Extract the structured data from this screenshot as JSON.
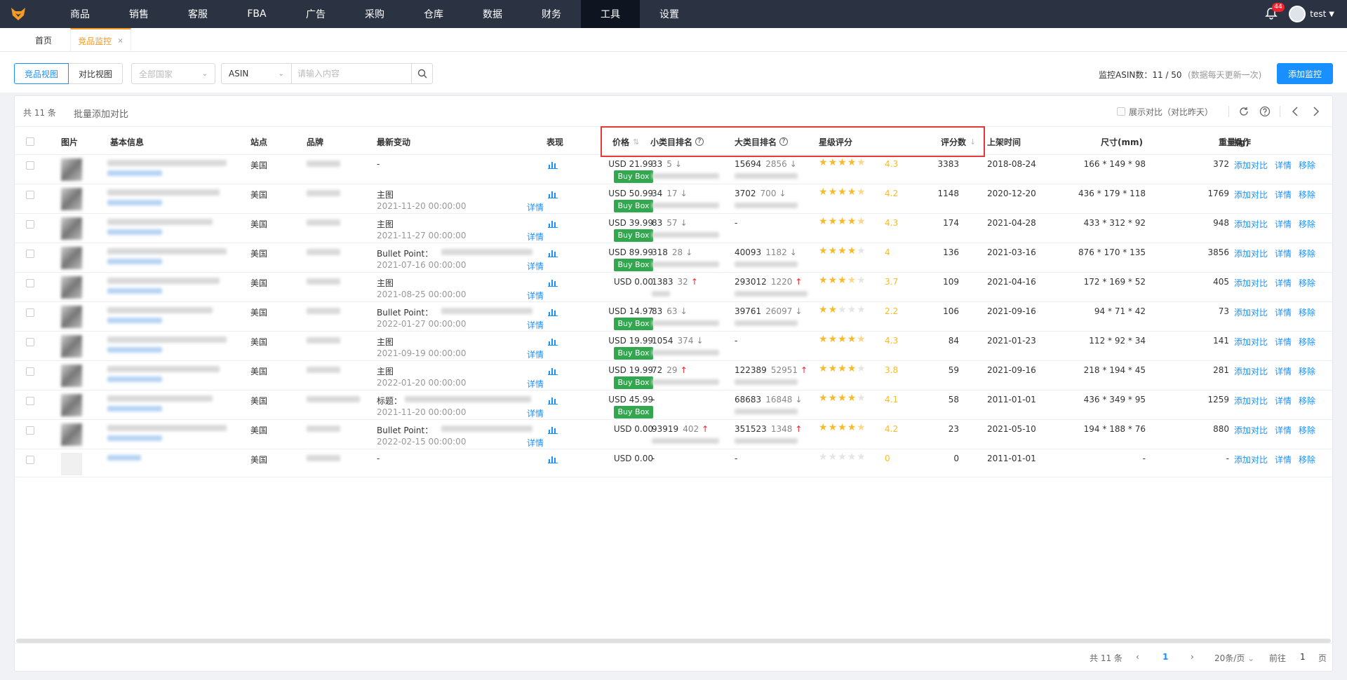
{
  "nav": {
    "items": [
      "商品",
      "销售",
      "客服",
      "FBA",
      "广告",
      "采购",
      "仓库",
      "数据",
      "财务",
      "工具",
      "设置"
    ],
    "active_index": 9,
    "notification_count": "44",
    "user": "test"
  },
  "tabs": {
    "home": "首页",
    "current": "竞品监控",
    "close": "×"
  },
  "toolbar": {
    "view_competitor": "竞品视图",
    "view_compare": "对比视图",
    "country_placeholder": "全部国家",
    "search_type": "ASIN",
    "search_placeholder": "请输入内容",
    "monitor_count": "监控ASIN数：11 / 50",
    "monitor_note": "(数据每天更新一次)",
    "add_button": "添加监控"
  },
  "panel": {
    "total": "共 11 条",
    "batch_add": "批量添加对比",
    "show_compare": "展示对比（对比昨天）"
  },
  "table": {
    "headers": {
      "image": "图片",
      "basic_info": "基本信息",
      "site": "站点",
      "brand": "品牌",
      "latest_change": "最新变动",
      "performance": "表现",
      "price": "价格",
      "small_rank": "小类目排名",
      "big_rank": "大类目排名",
      "star_rating": "星级评分",
      "review_count": "评分数",
      "listing_time": "上架时间",
      "size": "尺寸(mm)",
      "weight": "重量(g)",
      "actions": "操作"
    },
    "action_add_compare": "添加对比",
    "action_detail": "详情",
    "action_remove": "移除",
    "detail_link": "详情",
    "buy_box": "Buy Box",
    "rows": [
      {
        "site": "美国",
        "change": "-",
        "change_time": "",
        "price": "USD 21.99",
        "buybox": true,
        "small_rank": "33",
        "small_delta": "5",
        "small_dir": "down",
        "big_rank": "15694",
        "big_delta": "2856",
        "big_dir": "down",
        "stars": 4.5,
        "rating": "4.3",
        "reviews": "3383",
        "listed": "2018-08-24",
        "size": "166 * 149 * 98",
        "weight": "372"
      },
      {
        "site": "美国",
        "change": "主图",
        "change_time": "2021-11-20 00:00:00",
        "price": "USD 50.99",
        "buybox": true,
        "small_rank": "34",
        "small_delta": "17",
        "small_dir": "down",
        "big_rank": "3702",
        "big_delta": "700",
        "big_dir": "down",
        "stars": 4.5,
        "rating": "4.2",
        "reviews": "1148",
        "listed": "2020-12-20",
        "size": "436 * 179 * 118",
        "weight": "1769"
      },
      {
        "site": "美国",
        "change": "主图",
        "change_time": "2021-11-27 00:00:00",
        "price": "USD 39.99",
        "buybox": true,
        "small_rank": "83",
        "small_delta": "57",
        "small_dir": "down",
        "big_rank": "-",
        "big_delta": "",
        "big_dir": "",
        "stars": 4.5,
        "rating": "4.3",
        "reviews": "174",
        "listed": "2021-04-28",
        "size": "433 * 312 * 92",
        "weight": "948"
      },
      {
        "site": "美国",
        "change": "Bullet Point：",
        "change_time": "2021-07-16 00:00:00",
        "price": "USD 89.99",
        "buybox": true,
        "small_rank": "318",
        "small_delta": "28",
        "small_dir": "down",
        "big_rank": "40093",
        "big_delta": "1182",
        "big_dir": "down",
        "stars": 4,
        "rating": "4",
        "reviews": "136",
        "listed": "2021-03-16",
        "size": "876 * 170 * 135",
        "weight": "3856"
      },
      {
        "site": "美国",
        "change": "主图",
        "change_time": "2021-08-25 00:00:00",
        "price": "USD 0.00",
        "buybox": false,
        "small_rank": "1383",
        "small_delta": "32",
        "small_dir": "up",
        "big_rank": "293012",
        "big_delta": "1220",
        "big_dir": "up",
        "stars": 3.5,
        "rating": "3.7",
        "reviews": "109",
        "listed": "2021-04-16",
        "size": "172 * 169 * 52",
        "weight": "405"
      },
      {
        "site": "美国",
        "change": "Bullet Point：",
        "change_time": "2022-01-27 00:00:00",
        "price": "USD 14.97",
        "buybox": true,
        "small_rank": "83",
        "small_delta": "63",
        "small_dir": "down",
        "big_rank": "39761",
        "big_delta": "26097",
        "big_dir": "down",
        "stars": 2,
        "rating": "2.2",
        "reviews": "106",
        "listed": "2021-09-16",
        "size": "94 * 71 * 42",
        "weight": "73"
      },
      {
        "site": "美国",
        "change": "主图",
        "change_time": "2021-09-19 00:00:00",
        "price": "USD 19.99",
        "buybox": true,
        "small_rank": "1054",
        "small_delta": "374",
        "small_dir": "down",
        "big_rank": "-",
        "big_delta": "",
        "big_dir": "",
        "stars": 4.5,
        "rating": "4.3",
        "reviews": "84",
        "listed": "2021-01-23",
        "size": "112 * 92 * 34",
        "weight": "141"
      },
      {
        "site": "美国",
        "change": "主图",
        "change_time": "2022-01-20 00:00:00",
        "price": "USD 19.99",
        "buybox": true,
        "small_rank": "72",
        "small_delta": "29",
        "small_dir": "up",
        "big_rank": "122389",
        "big_delta": "52951",
        "big_dir": "up",
        "stars": 4,
        "rating": "3.8",
        "reviews": "59",
        "listed": "2021-09-16",
        "size": "218 * 194 * 45",
        "weight": "281"
      },
      {
        "site": "美国",
        "change": "标题：",
        "change_time": "2021-11-20 00:00:00",
        "price": "USD 45.99",
        "buybox": true,
        "small_rank": "-",
        "small_delta": "",
        "small_dir": "",
        "big_rank": "68683",
        "big_delta": "16848",
        "big_dir": "down",
        "stars": 4,
        "rating": "4.1",
        "reviews": "58",
        "listed": "2011-01-01",
        "size": "436 * 349 * 95",
        "weight": "1259"
      },
      {
        "site": "美国",
        "change": "Bullet Point：",
        "change_time": "2022-02-15 00:00:00",
        "price": "USD 0.00",
        "buybox": false,
        "small_rank": "93919",
        "small_delta": "402",
        "small_dir": "up",
        "big_rank": "351523",
        "big_delta": "1348",
        "big_dir": "up",
        "stars": 4.5,
        "rating": "4.2",
        "reviews": "23",
        "listed": "2021-05-10",
        "size": "194 * 188 * 76",
        "weight": "880"
      },
      {
        "site": "美国",
        "change": "-",
        "change_time": "",
        "price": "USD 0.00",
        "buybox": false,
        "small_rank": "-",
        "small_delta": "",
        "small_dir": "",
        "big_rank": "-",
        "big_delta": "",
        "big_dir": "",
        "stars": 0,
        "rating": "0",
        "reviews": "0",
        "listed": "2011-01-01",
        "size": "-",
        "weight": "-"
      }
    ]
  },
  "pagination": {
    "total": "共 11 条",
    "current_page": "1",
    "page_size": "20条/页",
    "goto_label": "前往",
    "goto_value": "1",
    "page_suffix": "页"
  },
  "colors": {
    "nav_bg": "#2b3242",
    "accent": "#1890ff",
    "active_tab": "#f59a23",
    "buybox": "#31a84d",
    "star": "#f7ba2a",
    "highlight_box": "#e53935"
  }
}
